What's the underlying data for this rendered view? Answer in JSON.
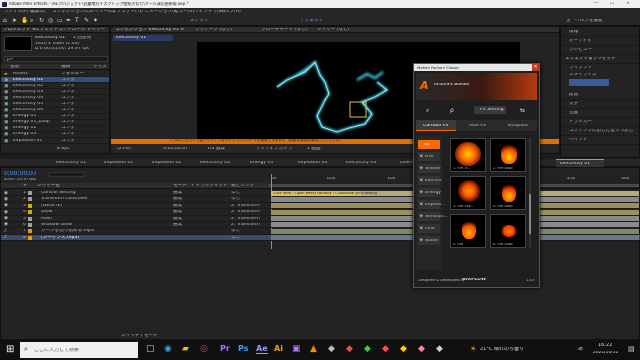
{
  "window": {
    "title": "Adobe After Effects - \\AEプロジェクト\\近畿地方デスクトップ壁紙大切り\\クール演出更新版.aep *",
    "min": "—",
    "max": "☐",
    "close": "✕"
  },
  "menu": [
    "ファイル(F)",
    "編集(E)",
    "コンポジション(C)",
    "レイヤー(L)",
    "エフェクト(T)",
    "アニメーション(A)",
    "ビュー(V)",
    "ウィンドウ(W)",
    "ヘルプ(H)"
  ],
  "toolbar": {
    "snap_label": "スナップ",
    "workspace": "デフォルト",
    "search_label": "ヘルプを検索"
  },
  "project": {
    "tabs": [
      "プロジェクト ≡",
      "エフェクトコントロール レイヤー"
    ],
    "selected_name": "Electricity 01",
    "selected_info": [
      "1920 x 1080 (1.00)",
      "Δ 0;00;05;00, 29.97 fps"
    ],
    "used_label": "1 回使用",
    "search_placeholder": "ρ+",
    "columns": [
      "名前",
      "種類",
      "サイズ"
    ],
    "items": [
      {
        "name": "Assets",
        "type": "フォルダー"
      },
      {
        "name": "Electricity 01",
        "type": "コンポ",
        "selected": true
      },
      {
        "name": "Electricity 02",
        "type": "コンポ"
      },
      {
        "name": "Electricity 03",
        "type": "コンポ"
      },
      {
        "name": "Electricity 04",
        "type": "コンポ"
      },
      {
        "name": "Electricity 05",
        "type": "コンポ"
      },
      {
        "name": "Electricity 06",
        "type": "コンポ"
      },
      {
        "name": "Energy 01",
        "type": "コンポ"
      },
      {
        "name": "Energy 01_Loop",
        "type": "コンポ"
      },
      {
        "name": "Energy 02",
        "type": "コンポ"
      },
      {
        "name": "Energy 03",
        "type": "コンポ"
      },
      {
        "name": "Explosion 01",
        "type": "コンポ"
      }
    ],
    "footer": "8 bpc"
  },
  "viewer": {
    "tabs": [
      "コンポジション Electricity 01 ≡",
      "フッテージ (なし)",
      "フローチャート (なし)",
      "レイヤー (なし)"
    ],
    "comp_tab": "Electricity 01",
    "zoom": "(25%)",
    "timecode": "0;00;00;07",
    "resolution": "1/4 画質",
    "camera": "アクティブカメラ",
    "views": "1 画面",
    "warning": "このエフェクトではアクティブなライトコントロールを使用できません（必要な場合は追加してください）"
  },
  "right_panel": {
    "items": [
      "情報",
      "オーディオ",
      "プレビュー",
      "エフェクト＆プリセット",
      "ライブラリ",
      "スタイライズ",
      "段落",
      "文字",
      "位置",
      "トラッカー",
      "コンテンツに応じた塗りつぶし",
      "ペイント"
    ]
  },
  "plugin": {
    "title": "Motion Factory Classic",
    "brand": "ActionFx Builder",
    "tools": [
      "⌕",
      "ρ",
      "FX Setting",
      "⇆"
    ],
    "tabs": [
      "Cartoon FX",
      "Real FX",
      "Template"
    ],
    "categories": [
      "All",
      "Fire",
      "Smoke",
      "Electric",
      "Energy",
      "Explosi...",
      "Simulati...",
      "Line",
      "Water"
    ],
    "items": [
      {
        "label": "1. Fire Tr...",
        "color": "#ff6a00"
      },
      {
        "label": "2. Fire Loop",
        "color": "#ff4a00"
      },
      {
        "label": "3. Fire Exp...",
        "color": "#ff5500"
      },
      {
        "label": "4. Fire Loop",
        "color": "#ff3b00"
      },
      {
        "label": "5. Fire",
        "color": "#ff5200"
      },
      {
        "label": "6. Fire Loop",
        "color": "#ff4000"
      }
    ],
    "footer_left": "Designed & Developed by",
    "footer_brand": "ΘIXFLOW",
    "footer_right": "1.43"
  },
  "comp_tabs": [
    "Electricity 01",
    "Explosion 01",
    "Explosion 02",
    "Electricity 02",
    "Energy 01",
    "Explosion 03",
    "Electricity 03",
    "Line 01",
    "Line 02"
  ],
  "timeline": {
    "timecode": "0;00;00;07",
    "fps": "00007 (29.97 fps)",
    "headers": [
      "#",
      "レイヤー名",
      "モード",
      "T トラックマット",
      "親とリンク"
    ],
    "layers": [
      {
        "num": "1",
        "name": "Control Setting",
        "mode": "通常",
        "parent": "なし",
        "color": "#a0a0a0"
      },
      {
        "num": "2",
        "name": "Transform Controller",
        "mode": "通常",
        "parent": "なし",
        "color": "#a0a0a0"
      },
      {
        "num": "3",
        "name": "[DELETE]",
        "mode": "通常",
        "parent": "2. Transform",
        "color": "#c8b400"
      },
      {
        "num": "4",
        "name": "Glow",
        "mode": "通常",
        "parent": "2. Transform",
        "color": "#c8b400"
      },
      {
        "num": "5",
        "name": "Main",
        "mode": "通常",
        "parent": "2. Transform",
        "color": "#a0a0a0"
      },
      {
        "num": "6",
        "name": "Shadow Glow",
        "mode": "通常",
        "parent": "2. Transform",
        "color": "#a0a0a0"
      },
      {
        "num": "7",
        "name": "シーンを切り込める.mp3",
        "mode": "",
        "parent": "なし",
        "color": "#e8a000"
      },
      {
        "num": "8",
        "name": "[シーケンス.mp3]",
        "mode": "",
        "parent": "なし",
        "color": "#e8a000",
        "selected": true
      }
    ],
    "note": "Click Here ! Open effect controls ! Customize your setting",
    "footer": "スイッチ / モード",
    "ruler": [
      "0s",
      "05s",
      "10s",
      "15s",
      "20s",
      "25s",
      "30s"
    ]
  },
  "taskbar": {
    "search_placeholder": "ここに入力して検索",
    "weather": "21°C 晴れのち曇り",
    "ime": "あ",
    "time": "16:22",
    "date": "2021/10/11"
  }
}
